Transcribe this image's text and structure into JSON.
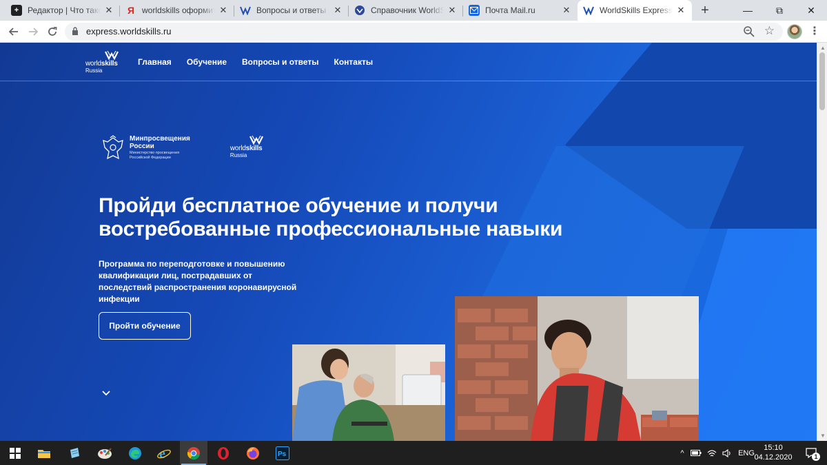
{
  "browser": {
    "tabs": [
      {
        "title": "Редактор | Что такое W",
        "favicon": "plus-square-icon",
        "active": false
      },
      {
        "title": "worldskills оформить за",
        "favicon": "yandex-icon",
        "active": false
      },
      {
        "title": "Вопросы и ответы | Wo",
        "favicon": "worldskills-icon",
        "active": false
      },
      {
        "title": "Справочник WorldSkills",
        "favicon": "emblem-icon",
        "active": false
      },
      {
        "title": "Почта Mail.ru",
        "favicon": "mail-icon",
        "active": false
      },
      {
        "title": "WorldSkills Express: Гла",
        "favicon": "worldskills-icon",
        "active": true
      }
    ],
    "address": "express.worldskills.ru"
  },
  "site": {
    "logo": {
      "word1": "world",
      "word2": "skills",
      "region": "Russia"
    },
    "nav": [
      {
        "label": "Главная"
      },
      {
        "label": "Обучение"
      },
      {
        "label": "Вопросы и ответы"
      },
      {
        "label": "Контакты"
      }
    ],
    "partners": {
      "ministry_name_line1": "Минпросвещения",
      "ministry_name_line2": "России",
      "ministry_subtitle": "Министерство просвещения Российской Федерации"
    },
    "hero": {
      "title_line1": "Пройди бесплатное обучение и получи",
      "title_line2": "востребованные профессиональные навыки",
      "subtitle": "Программа по переподготовке и повышению квалификации лиц, пострадавших от последствий распространения коронавирусной инфекции",
      "cta": "Пройти обучение"
    },
    "colors": {
      "background": "#1549b8",
      "accent": "#2680ff",
      "text": "#ffffff"
    }
  },
  "taskbar": {
    "language": "ENG",
    "time": "15:10",
    "date": "04.12.2020",
    "notifications": "1",
    "apps": [
      "windows-start-icon",
      "file-explorer-icon",
      "notepad-icon",
      "paint-icon",
      "edge-icon",
      "internet-explorer-icon",
      "chrome-icon",
      "opera-icon",
      "firefox-icon",
      "photoshop-icon"
    ]
  }
}
